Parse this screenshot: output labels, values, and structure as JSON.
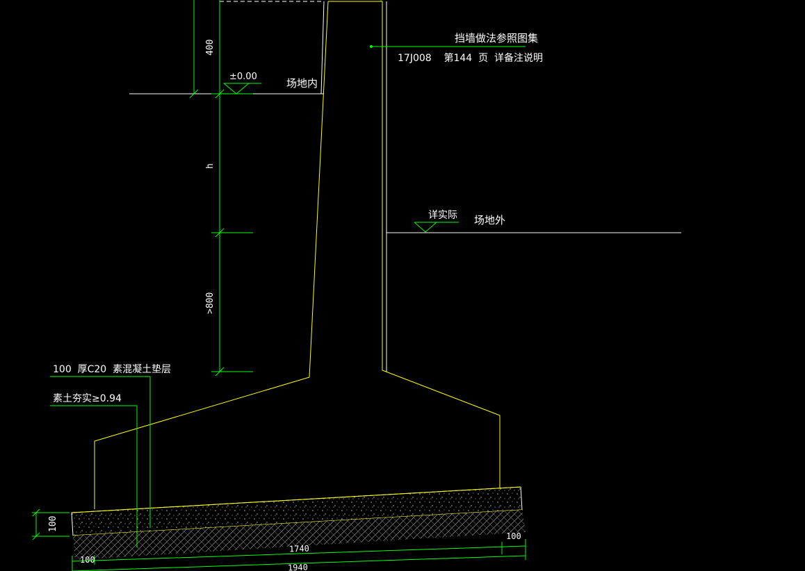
{
  "labels": {
    "ref_line1": "挡墙做法参照图集",
    "ref_line2": "17J008    第144  页  详备注说明",
    "level_inside_value": "±0.00",
    "site_inside": "场地内",
    "level_outside_value": "详实际",
    "site_outside": "场地外",
    "cushion_note": "100  厚C20  素混凝土垫层",
    "soil_note": "素土夯实≥0.94"
  },
  "dimensions": {
    "top_height": "400",
    "wall_height": "h",
    "embed_depth": ">800",
    "cushion_thickness": "100",
    "base_width": "1740",
    "total_width": "1940",
    "left_offset": "100",
    "right_offset": "100"
  },
  "colors": {
    "background": "#000000",
    "wall": "#ffff00",
    "dimension": "#00ff00",
    "ground": "#ffffff",
    "text": "#ffffff"
  }
}
